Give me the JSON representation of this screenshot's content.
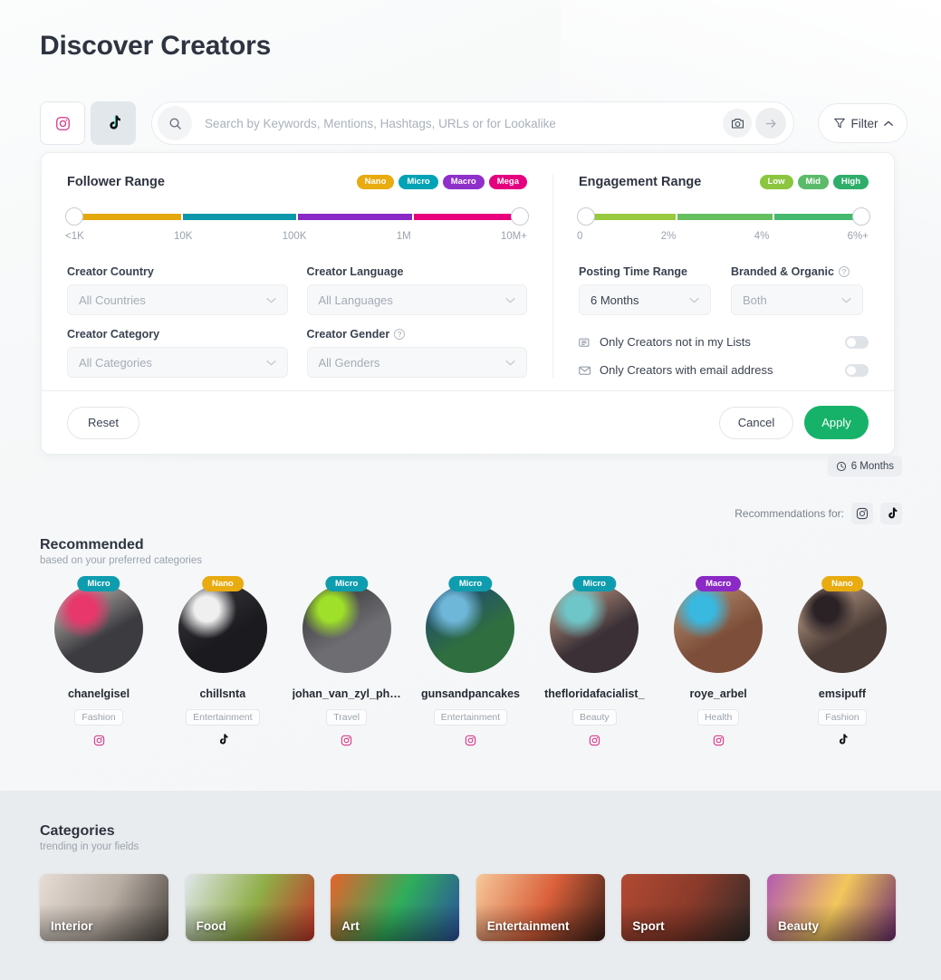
{
  "page": {
    "title": "Discover Creators"
  },
  "platform_toggle": [
    {
      "name": "instagram",
      "label": "Instagram",
      "active": false
    },
    {
      "name": "tiktok",
      "label": "TikTok",
      "active": true
    }
  ],
  "search": {
    "placeholder": "Search by Keywords, Mentions, Hashtags, URLs or for Lookalike",
    "value": "",
    "camera_icon": "camera-icon",
    "submit_icon": "arrow-right-icon",
    "search_icon": "search-icon"
  },
  "filter_button": {
    "label": "Filter",
    "icon": "funnel-icon",
    "chevron": "chevron-up-icon"
  },
  "filter_panel": {
    "follower": {
      "title": "Follower Range",
      "chips": [
        {
          "label": "Nano",
          "color": "#e8ab10"
        },
        {
          "label": "Micro",
          "color": "#00a3b5"
        },
        {
          "label": "Macro",
          "color": "#8e30c9"
        },
        {
          "label": "Mega",
          "color": "#e5007e"
        }
      ],
      "segments": [
        {
          "color": "#e3a80c",
          "flex": 25
        },
        {
          "color": "#0e97ab",
          "flex": 25
        },
        {
          "color": "#8a29c6",
          "flex": 25
        },
        {
          "color": "#e8007c",
          "flex": 25
        }
      ],
      "ticks": [
        "<1K",
        "10K",
        "100K",
        "1M",
        "10M+"
      ]
    },
    "engagement": {
      "title": "Engagement Range",
      "chips": [
        {
          "label": "Low",
          "color": "#8cc63f"
        },
        {
          "label": "Mid",
          "color": "#5cbb6a"
        },
        {
          "label": "High",
          "color": "#2fae6a"
        }
      ],
      "segments": [
        {
          "color": "#93c councillor",
          "flex": 33
        }
      ],
      "segments_fixed": [
        {
          "color": "#96c93d",
          "flex": 34
        },
        {
          "color": "#66bf5f",
          "flex": 33
        },
        {
          "color": "#45b96e",
          "flex": 33
        }
      ],
      "ticks": [
        "0",
        "2%",
        "4%",
        "6%+"
      ]
    },
    "fields": {
      "creator_country": {
        "label": "Creator Country",
        "value": "All Countries"
      },
      "creator_language": {
        "label": "Creator Language",
        "value": "All Languages"
      },
      "creator_category": {
        "label": "Creator Category",
        "value": "All Categories"
      },
      "creator_gender": {
        "label": "Creator Gender",
        "value": "All Genders",
        "help": "?"
      },
      "posting_time_range": {
        "label": "Posting Time Range",
        "value": "6 Months"
      },
      "branded_organic": {
        "label": "Branded & Organic",
        "value": "Both",
        "help": "?"
      }
    },
    "toggles": [
      {
        "label": "Only Creators not in my Lists",
        "icon": "list-icon",
        "on": false
      },
      {
        "label": "Only Creators with email address",
        "icon": "envelope-icon",
        "on": false
      }
    ],
    "footer": {
      "reset": "Reset",
      "cancel": "Cancel",
      "apply": "Apply"
    }
  },
  "months_pill": {
    "label": "6 Months",
    "icon": "clock-icon"
  },
  "recommendations_for": {
    "label": "Recommendations for:",
    "buttons": [
      {
        "name": "instagram",
        "icon": "instagram-icon"
      },
      {
        "name": "tiktok",
        "icon": "tiktok-icon"
      }
    ]
  },
  "recommended": {
    "title": "Recommended",
    "subtitle": "based on your preferred categories",
    "creators": [
      {
        "name": "chanelgisel",
        "badge": "Micro",
        "badge_color": "#0e9dae",
        "tag": "Fashion",
        "platform": "instagram",
        "av1": "#3b3b40",
        "av2": "#d9cfc6",
        "av3": "#e8376b"
      },
      {
        "name": "chillsnta",
        "badge": "Nano",
        "badge_color": "#e8ab10",
        "tag": "Entertainment",
        "platform": "tiktok",
        "av1": "#1b1b1f",
        "av2": "#3a3a40",
        "av3": "#efefef"
      },
      {
        "name": "johan_van_zyl_ph…",
        "badge": "Micro",
        "badge_color": "#0e9dae",
        "tag": "Travel",
        "platform": "instagram",
        "av1": "#6e6e72",
        "av2": "#2b2b2e",
        "av3": "#9fe02a"
      },
      {
        "name": "gunsandpancakes",
        "badge": "Micro",
        "badge_color": "#0e9dae",
        "tag": "Entertainment",
        "platform": "instagram",
        "av1": "#2f6e3f",
        "av2": "#1b3f84",
        "av3": "#6fb7d8"
      },
      {
        "name": "thefloridafacialist_",
        "badge": "Micro",
        "badge_color": "#0e9dae",
        "tag": "Beauty",
        "platform": "instagram",
        "av1": "#3a3036",
        "av2": "#d9a98f",
        "av3": "#6ec6c9"
      },
      {
        "name": "roye_arbel",
        "badge": "Macro",
        "badge_color": "#8a29c6",
        "tag": "Health",
        "platform": "instagram",
        "av1": "#7d4f3a",
        "av2": "#c0997a",
        "av3": "#39b8e0"
      },
      {
        "name": "emsipuff",
        "badge": "Nano",
        "badge_color": "#e8ab10",
        "tag": "Fashion",
        "platform": "tiktok",
        "av1": "#4a3b36",
        "av2": "#d9b79c",
        "av3": "#2b2226"
      }
    ]
  },
  "categories": {
    "title": "Categories",
    "subtitle": "trending in your fields",
    "items": [
      {
        "label": "Interior",
        "c1": "#e6ddd5",
        "c2": "#b9aea4",
        "c3": "#4a4540"
      },
      {
        "label": "Food",
        "c1": "#dfe6ea",
        "c2": "#8fae47",
        "c3": "#c6332a"
      },
      {
        "label": "Art",
        "c1": "#e8622a",
        "c2": "#2fae5a",
        "c3": "#2b4fa0"
      },
      {
        "label": "Entertainment",
        "c1": "#f6c89a",
        "c2": "#d9603a",
        "c3": "#3a1f18"
      },
      {
        "label": "Sport",
        "c1": "#b24a33",
        "c2": "#8a3a2a",
        "c3": "#2e2a28"
      },
      {
        "label": "Beauty",
        "c1": "#b35ab0",
        "c2": "#f2c75c",
        "c3": "#6b2a6e"
      }
    ]
  }
}
